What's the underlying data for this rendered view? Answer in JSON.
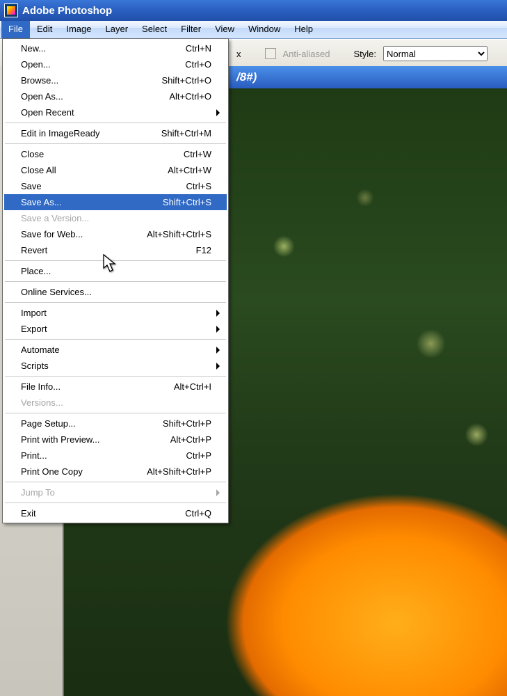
{
  "title": "Adobe Photoshop",
  "menubar": [
    "File",
    "Edit",
    "Image",
    "Layer",
    "Select",
    "Filter",
    "View",
    "Window",
    "Help"
  ],
  "menubar_open_index": 0,
  "optbar": {
    "x_suffix": "x",
    "anti_aliased_label": "Anti-aliased",
    "style_label": "Style:",
    "style_value": "Normal"
  },
  "doc_title_fragment": "/8#)",
  "file_menu": [
    [
      {
        "label": "New...",
        "shortcut": "Ctrl+N"
      },
      {
        "label": "Open...",
        "shortcut": "Ctrl+O"
      },
      {
        "label": "Browse...",
        "shortcut": "Shift+Ctrl+O"
      },
      {
        "label": "Open As...",
        "shortcut": "Alt+Ctrl+O"
      },
      {
        "label": "Open Recent",
        "submenu": true
      }
    ],
    [
      {
        "label": "Edit in ImageReady",
        "shortcut": "Shift+Ctrl+M"
      }
    ],
    [
      {
        "label": "Close",
        "shortcut": "Ctrl+W"
      },
      {
        "label": "Close All",
        "shortcut": "Alt+Ctrl+W"
      },
      {
        "label": "Save",
        "shortcut": "Ctrl+S"
      },
      {
        "label": "Save As...",
        "shortcut": "Shift+Ctrl+S",
        "highlight": true
      },
      {
        "label": "Save a Version...",
        "disabled": true
      },
      {
        "label": "Save for Web...",
        "shortcut": "Alt+Shift+Ctrl+S"
      },
      {
        "label": "Revert",
        "shortcut": "F12"
      }
    ],
    [
      {
        "label": "Place..."
      }
    ],
    [
      {
        "label": "Online Services..."
      }
    ],
    [
      {
        "label": "Import",
        "submenu": true
      },
      {
        "label": "Export",
        "submenu": true
      }
    ],
    [
      {
        "label": "Automate",
        "submenu": true
      },
      {
        "label": "Scripts",
        "submenu": true
      }
    ],
    [
      {
        "label": "File Info...",
        "shortcut": "Alt+Ctrl+I"
      },
      {
        "label": "Versions...",
        "disabled": true
      }
    ],
    [
      {
        "label": "Page Setup...",
        "shortcut": "Shift+Ctrl+P"
      },
      {
        "label": "Print with Preview...",
        "shortcut": "Alt+Ctrl+P"
      },
      {
        "label": "Print...",
        "shortcut": "Ctrl+P"
      },
      {
        "label": "Print One Copy",
        "shortcut": "Alt+Shift+Ctrl+P"
      }
    ],
    [
      {
        "label": "Jump To",
        "submenu": true,
        "disabled": true
      }
    ],
    [
      {
        "label": "Exit",
        "shortcut": "Ctrl+Q"
      }
    ]
  ]
}
